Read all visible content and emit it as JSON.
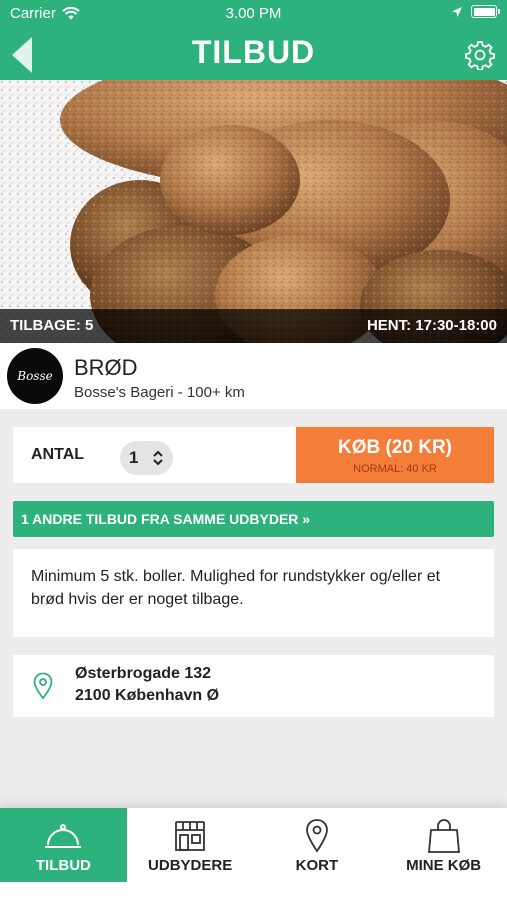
{
  "status_bar": {
    "carrier": "Carrier",
    "time": "3.00 PM"
  },
  "nav": {
    "title": "TILBUD"
  },
  "hero": {
    "left_label": "TILBAGE: 5",
    "right_label": "HENT: 17:30-18:00"
  },
  "provider": {
    "logo_text": "Bosse",
    "title": "BRØD",
    "subtitle": "Bosse's Bageri - 100+ km"
  },
  "purchase": {
    "antal_label": "ANTAL",
    "quantity": "1",
    "buy_label": "KØB (20 KR)",
    "normal_price": "NORMAL: 40 KR"
  },
  "more_offers": "1 ANDRE TILBUD FRA SAMME UDBYDER »",
  "description": "Minimum 5 stk. boller. Mulighed for rundstykker og/eller et brød hvis der er noget tilbage.",
  "address": {
    "line1": "Østerbrogade 132",
    "line2": "2100 København Ø"
  },
  "tabs": [
    {
      "label": "TILBUD",
      "icon": "cloche-icon",
      "active": true
    },
    {
      "label": "UDBYDERE",
      "icon": "store-icon",
      "active": false
    },
    {
      "label": "KORT",
      "icon": "map-pin-icon",
      "active": false
    },
    {
      "label": "MINE KØB",
      "icon": "shopping-bag-icon",
      "active": false
    }
  ],
  "colors": {
    "accent": "#2db27d",
    "buy": "#f47d3a"
  }
}
